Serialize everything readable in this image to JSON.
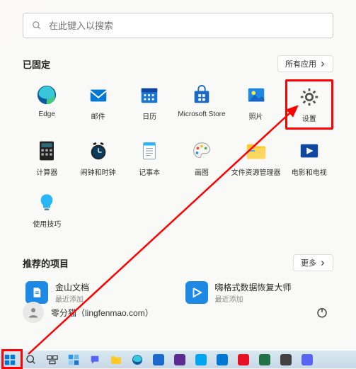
{
  "search": {
    "placeholder": "在此键入以搜索"
  },
  "pinned": {
    "title": "已固定",
    "all_apps": "所有应用",
    "apps": [
      {
        "name": "Edge",
        "label": "Edge"
      },
      {
        "name": "mail",
        "label": "邮件"
      },
      {
        "name": "calendar",
        "label": "日历"
      },
      {
        "name": "store",
        "label": "Microsoft Store"
      },
      {
        "name": "photos",
        "label": "照片"
      },
      {
        "name": "settings",
        "label": "设置"
      },
      {
        "name": "calculator",
        "label": "计算器"
      },
      {
        "name": "clock",
        "label": "闹钟和时钟"
      },
      {
        "name": "notepad",
        "label": "记事本"
      },
      {
        "name": "paint",
        "label": "画图"
      },
      {
        "name": "explorer",
        "label": "文件资源管理器"
      },
      {
        "name": "movies",
        "label": "电影和电视"
      },
      {
        "name": "tips",
        "label": "使用技巧"
      }
    ]
  },
  "recommended": {
    "title": "推荐的项目",
    "more": "更多",
    "items": [
      {
        "title": "金山文档",
        "sub": "最近添加"
      },
      {
        "title": "嗨格式数据恢复大师",
        "sub": "最近添加"
      }
    ]
  },
  "user": {
    "label": "零分猫（lingfenmao.com）"
  }
}
